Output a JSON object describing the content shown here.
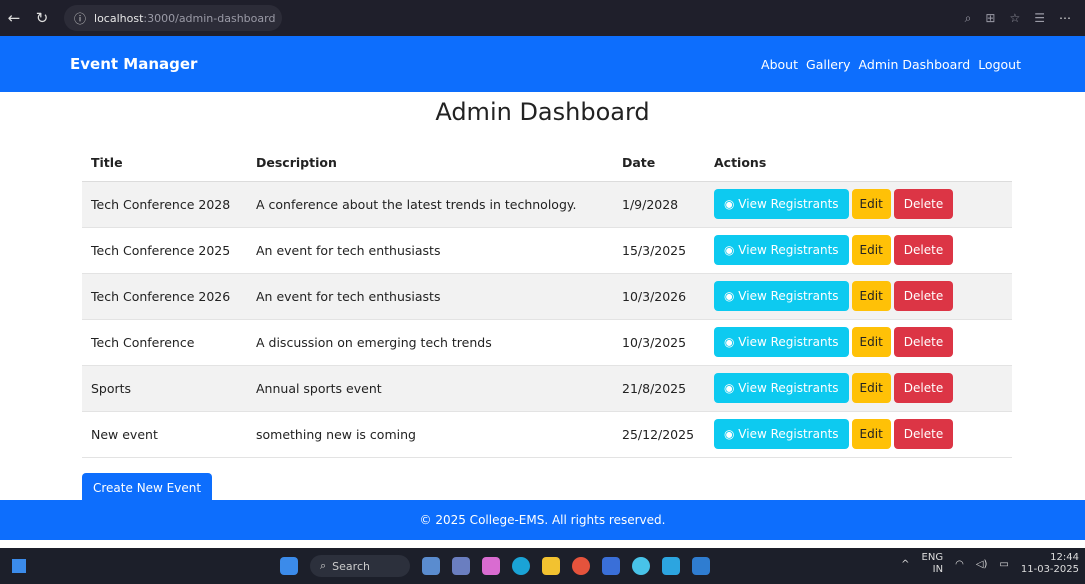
{
  "browser": {
    "url_host": "localhost",
    "url_path": ":3000/admin-dashboard"
  },
  "navbar": {
    "brand": "Event Manager",
    "links": [
      "About",
      "Gallery",
      "Admin Dashboard",
      "Logout"
    ]
  },
  "page": {
    "title": "Admin Dashboard"
  },
  "table": {
    "headers": [
      "Title",
      "Description",
      "Date",
      "Actions"
    ],
    "rows": [
      {
        "title": "Tech Conference 2028",
        "description": "A conference about the latest trends in technology.",
        "date": "1/9/2028"
      },
      {
        "title": "Tech Conference 2025",
        "description": "An event for tech enthusiasts",
        "date": "15/3/2025"
      },
      {
        "title": "Tech Conference 2026",
        "description": "An event for tech enthusiasts",
        "date": "10/3/2026"
      },
      {
        "title": "Tech Conference",
        "description": "A discussion on emerging tech trends",
        "date": "10/3/2025"
      },
      {
        "title": "Sports",
        "description": "Annual sports event",
        "date": "21/8/2025"
      },
      {
        "title": "New event",
        "description": "something new is coming",
        "date": "25/12/2025"
      }
    ],
    "actions": {
      "view": "View Registrants",
      "edit": "Edit",
      "delete": "Delete"
    }
  },
  "create_button": "Create New Event",
  "footer": "© 2025 College-EMS. All rights reserved.",
  "taskbar": {
    "search": "Search",
    "lang_top": "ENG",
    "lang_bottom": "IN",
    "time": "12:44",
    "date": "11-03-2025"
  },
  "colors": {
    "primary": "#0d6efd",
    "info": "#0dcaf0",
    "warning": "#ffc107",
    "danger": "#dc3545"
  }
}
